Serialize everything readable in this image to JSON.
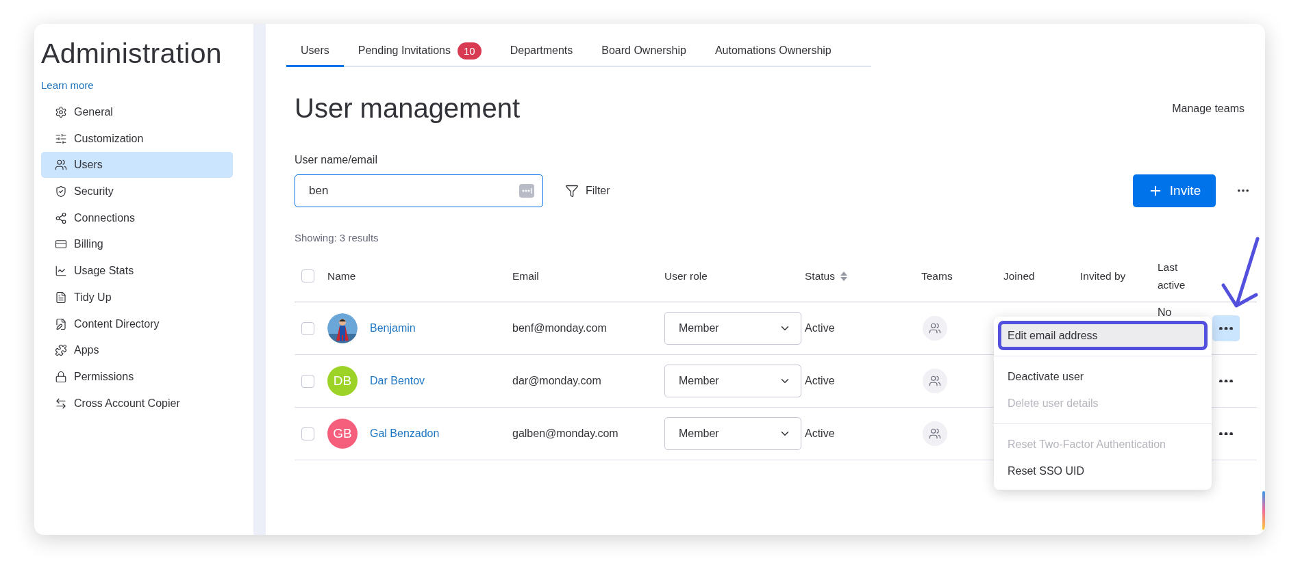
{
  "sidebar": {
    "title": "Administration",
    "link": "Learn more",
    "items": [
      {
        "label": "General",
        "selected": false
      },
      {
        "label": "Customization",
        "selected": false
      },
      {
        "label": "Users",
        "selected": true
      },
      {
        "label": "Security",
        "selected": false
      },
      {
        "label": "Connections",
        "selected": false
      },
      {
        "label": "Billing",
        "selected": false
      },
      {
        "label": "Usage Stats",
        "selected": false
      },
      {
        "label": "Tidy Up",
        "selected": false
      },
      {
        "label": "Content Directory",
        "selected": false
      },
      {
        "label": "Apps",
        "selected": false
      },
      {
        "label": "Permissions",
        "selected": false
      },
      {
        "label": "Cross Account Copier",
        "selected": false
      }
    ]
  },
  "tabs": [
    {
      "label": "Users",
      "selected": true
    },
    {
      "label": "Pending Invitations",
      "badge": "10",
      "selected": false
    },
    {
      "label": "Departments",
      "selected": false
    },
    {
      "label": "Board Ownership",
      "selected": false
    },
    {
      "label": "Automations Ownership",
      "selected": false
    }
  ],
  "header": {
    "title": "User management",
    "action": "Manage teams"
  },
  "search": {
    "label": "User name/email",
    "value": "ben"
  },
  "filter": "Filter",
  "invite": "Invite",
  "results": "Showing: 3 results",
  "table": {
    "select_all_checked": false,
    "columns": [
      {
        "label": "Name",
        "sortable": false
      },
      {
        "label": "Email",
        "sortable": false
      },
      {
        "label": "User role",
        "sortable": false
      },
      {
        "label": "Status",
        "sortable": true
      },
      {
        "label": "Teams",
        "sortable": false
      },
      {
        "label": "Joined",
        "sortable": false
      },
      {
        "label": "Invited by",
        "sortable": false
      },
      {
        "label": "Last active",
        "sortable": false
      }
    ],
    "rows": [
      {
        "checked": false,
        "name": "Benjamin",
        "email": "benf@monday.com",
        "role": "Member",
        "status": "Active",
        "last_active": "No",
        "menu_open": true
      },
      {
        "checked": false,
        "avatar": {
          "kind": "initials",
          "initials": "DB",
          "color": "#9cd326"
        },
        "name": "Dar Bentov",
        "email": "dar@monday.com",
        "role": "Member",
        "status": "Active",
        "menu_open": false
      },
      {
        "checked": false,
        "avatar": {
          "kind": "initials",
          "initials": "GB",
          "color": "#f65f7c"
        },
        "name": "Gal Benzadon",
        "email": "galben@monday.com",
        "role": "Member",
        "status": "Active",
        "menu_open": false
      }
    ]
  },
  "menu": {
    "items": [
      {
        "label": "Edit email address",
        "disabled": false,
        "highlighted": true,
        "divider_after": true
      },
      {
        "label": "Deactivate user",
        "disabled": false,
        "highlighted": false,
        "divider_after": false
      },
      {
        "label": "Delete user details",
        "disabled": true,
        "highlighted": false,
        "divider_after": true
      },
      {
        "label": "Reset Two-Factor Authentication",
        "disabled": true,
        "highlighted": false,
        "divider_after": false
      },
      {
        "label": "Reset SSO UID",
        "disabled": false,
        "highlighted": false,
        "divider_after": false
      }
    ]
  }
}
